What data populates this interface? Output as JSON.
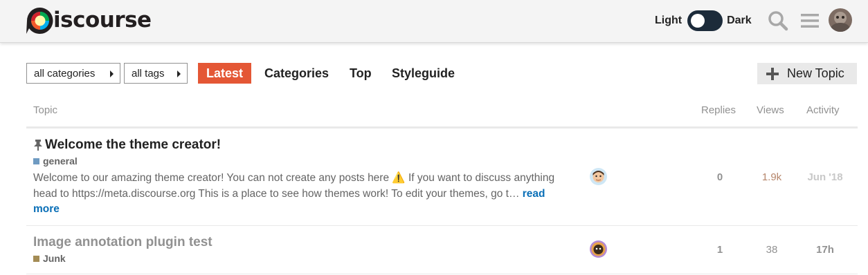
{
  "header": {
    "logo_text": "iscourse",
    "theme_light_label": "Light",
    "theme_dark_label": "Dark",
    "icons": [
      "search-icon",
      "hamburger-menu-icon",
      "user-avatar"
    ],
    "brand_colors": [
      "#d0232b",
      "#f1592a",
      "#fff9ae",
      "#00aeef",
      "#00a94f",
      "#231f20"
    ]
  },
  "filters": {
    "categories_label": "all categories",
    "tags_label": "all tags"
  },
  "nav": {
    "tabs": [
      {
        "label": "Latest",
        "active": true
      },
      {
        "label": "Categories",
        "active": false
      },
      {
        "label": "Top",
        "active": false
      },
      {
        "label": "Styleguide",
        "active": false
      }
    ],
    "accent_color": "#e45735",
    "new_topic_label": "New Topic"
  },
  "table": {
    "columns": [
      "Topic",
      "Replies",
      "Views",
      "Activity"
    ],
    "rows": [
      {
        "pinned": true,
        "title": "Welcome the theme creator!",
        "category": "general",
        "category_color": "#6f9bc2",
        "excerpt": "Welcome to our amazing theme creator! You can not create any posts here ⚠️ If you want to discuss anything head to https://meta.discourse.org This is a place to see how themes work! To edit your themes, go t…",
        "read_more": "read more",
        "replies": "0",
        "views": "1.9k",
        "activity": "Jun '18"
      },
      {
        "pinned": false,
        "title": "Image annotation plugin test",
        "category": "Junk",
        "category_color": "#a48c55",
        "replies": "1",
        "views": "38",
        "activity": "17h"
      }
    ]
  }
}
